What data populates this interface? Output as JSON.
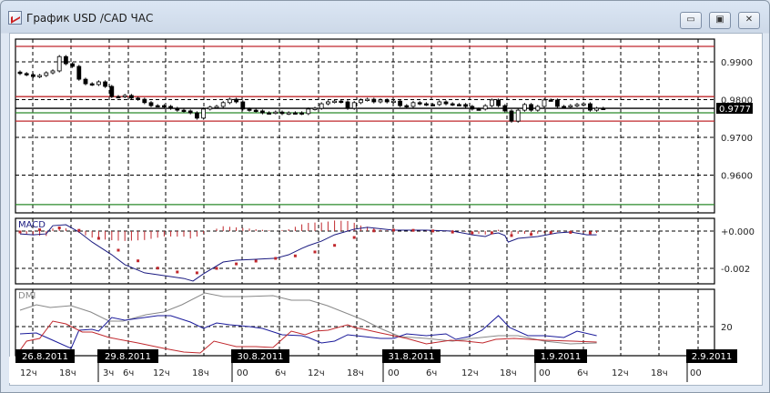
{
  "window": {
    "title": "График USD /CAD  ЧАС",
    "minimize_icon": "minimize-icon",
    "maximize_icon": "restore-icon",
    "close_icon": "close-icon"
  },
  "chart_data": [
    {
      "type": "candlestick",
      "title": "USD/CAD",
      "timeframe": "hourly",
      "y_ticks": [
        "0.9900",
        "0.9800",
        "0.9700",
        "0.9600"
      ],
      "ylim": [
        0.952,
        0.996
      ],
      "current_price": "0.9777",
      "levels": [
        {
          "price": 0.9941,
          "color": "#c0282d"
        },
        {
          "price": 0.9808,
          "color": "#c0282d"
        },
        {
          "price": 0.9743,
          "color": "#c0282d"
        },
        {
          "price": 0.9765,
          "color": "#2a8a2a"
        },
        {
          "price": 0.9522,
          "color": "#2a8a2a"
        },
        {
          "price": 0.9777,
          "color": "#000000"
        }
      ],
      "closes": [
        0.9869,
        0.9866,
        0.9861,
        0.9864,
        0.9871,
        0.9876,
        0.9914,
        0.9895,
        0.9888,
        0.9854,
        0.9842,
        0.984,
        0.9847,
        0.9835,
        0.9808,
        0.9808,
        0.9811,
        0.9804,
        0.9801,
        0.9792,
        0.9784,
        0.9784,
        0.9782,
        0.9777,
        0.9772,
        0.977,
        0.9765,
        0.9751,
        0.9775,
        0.978,
        0.9782,
        0.9792,
        0.9801,
        0.9794,
        0.9775,
        0.9772,
        0.977,
        0.9765,
        0.9765,
        0.9767,
        0.9763,
        0.9765,
        0.9765,
        0.9763,
        0.9775,
        0.9777,
        0.9789,
        0.9794,
        0.9796,
        0.9794,
        0.9777,
        0.9792,
        0.9799,
        0.9801,
        0.9794,
        0.9799,
        0.9794,
        0.9796,
        0.9784,
        0.9782,
        0.9792,
        0.9789,
        0.9787,
        0.9787,
        0.9794,
        0.9789,
        0.9787,
        0.9787,
        0.9782,
        0.9775,
        0.9775,
        0.9784,
        0.9799,
        0.9784,
        0.977,
        0.9743,
        0.9772,
        0.9787,
        0.9772,
        0.9782,
        0.9799,
        0.9799,
        0.9782,
        0.9782,
        0.9784,
        0.9787,
        0.9789,
        0.9772,
        0.9777,
        0.9777
      ]
    },
    {
      "type": "line",
      "title": "MACD",
      "y_ticks": [
        "+0.000",
        "-0.002"
      ],
      "units": "0.001",
      "macd": [
        [
          0,
          -0.15
        ],
        [
          2,
          -0.2
        ],
        [
          4,
          -0.15
        ],
        [
          5,
          0.29
        ],
        [
          7,
          0.34
        ],
        [
          9,
          -0.05
        ],
        [
          11,
          -0.59
        ],
        [
          14,
          -1.27
        ],
        [
          16,
          -1.8
        ],
        [
          19,
          -2.24
        ],
        [
          22,
          -2.39
        ],
        [
          25,
          -2.54
        ],
        [
          26.4,
          -2.68
        ],
        [
          28,
          -2.29
        ],
        [
          31,
          -1.66
        ],
        [
          33,
          -1.56
        ],
        [
          36,
          -1.51
        ],
        [
          39,
          -1.46
        ],
        [
          41,
          -1.27
        ],
        [
          43,
          -0.93
        ],
        [
          44,
          -0.78
        ],
        [
          46,
          -0.54
        ],
        [
          48,
          -0.2
        ],
        [
          51,
          0.1
        ],
        [
          53,
          0.2
        ],
        [
          57,
          0.05
        ],
        [
          62,
          0.05
        ],
        [
          66,
          0
        ],
        [
          69,
          -0.2
        ],
        [
          71,
          -0.29
        ],
        [
          72,
          -0.15
        ],
        [
          73,
          -0.1
        ],
        [
          74,
          -0.24
        ],
        [
          74.5,
          -0.59
        ],
        [
          76,
          -0.39
        ],
        [
          79,
          -0.29
        ],
        [
          82,
          -0.1
        ],
        [
          84,
          -0.05
        ],
        [
          86.5,
          -0.2
        ],
        [
          88,
          -0.2
        ]
      ],
      "signal": [
        [
          0,
          -0.05
        ],
        [
          5,
          0.15
        ],
        [
          7.4,
          0.2
        ],
        [
          9.4,
          0
        ],
        [
          12,
          -0.39
        ],
        [
          14,
          -0.78
        ],
        [
          16,
          -1.27
        ],
        [
          19,
          -1.76
        ],
        [
          22,
          -2.1
        ],
        [
          25,
          -2.24
        ],
        [
          27,
          -2.24
        ],
        [
          30,
          -2.0
        ],
        [
          33,
          -1.76
        ],
        [
          37,
          -1.56
        ],
        [
          41,
          -1.37
        ],
        [
          43.5,
          -1.27
        ],
        [
          45,
          -1.12
        ],
        [
          47,
          -0.88
        ],
        [
          50,
          -0.54
        ],
        [
          52.5,
          -0.05
        ],
        [
          55,
          0.05
        ],
        [
          59,
          0.05
        ],
        [
          63.6,
          0
        ],
        [
          68,
          -0.1
        ],
        [
          72,
          -0.1
        ],
        [
          74,
          -0.24
        ],
        [
          76,
          -0.24
        ],
        [
          79,
          -0.15
        ],
        [
          82,
          -0.05
        ],
        [
          87,
          -0.1
        ]
      ]
    },
    {
      "type": "line",
      "title": "DMI",
      "y_ticks": [
        "20"
      ],
      "adx": [
        [
          0,
          29
        ],
        [
          2.5,
          32
        ],
        [
          4.6,
          30.5
        ],
        [
          7.8,
          31.5
        ],
        [
          10.8,
          28
        ],
        [
          13.6,
          23
        ],
        [
          15.7,
          23
        ],
        [
          19.2,
          26.5
        ],
        [
          21.9,
          28
        ],
        [
          24.7,
          32
        ],
        [
          28.2,
          38.5
        ],
        [
          31,
          36.5
        ],
        [
          34.4,
          36.5
        ],
        [
          38.6,
          37
        ],
        [
          41.4,
          34.5
        ],
        [
          44.2,
          34.5
        ],
        [
          46.9,
          31.5
        ],
        [
          49.7,
          27.5
        ],
        [
          52.5,
          23.5
        ],
        [
          55.3,
          18.5
        ],
        [
          58,
          14.5
        ],
        [
          62,
          13.5
        ],
        [
          66,
          12
        ],
        [
          69,
          13.5
        ],
        [
          73,
          15
        ],
        [
          76,
          15
        ],
        [
          80,
          12
        ],
        [
          84,
          10.5
        ],
        [
          88,
          11
        ]
      ],
      "plus_di": [
        [
          0,
          16
        ],
        [
          2.5,
          16.5
        ],
        [
          5,
          12.5
        ],
        [
          7.8,
          8
        ],
        [
          9,
          18
        ],
        [
          11,
          18.5
        ],
        [
          12,
          17.5
        ],
        [
          14,
          25
        ],
        [
          16,
          23.5
        ],
        [
          18,
          24.5
        ],
        [
          21,
          26
        ],
        [
          23,
          26
        ],
        [
          26,
          22.5
        ],
        [
          28,
          19
        ],
        [
          30,
          22
        ],
        [
          32,
          21
        ],
        [
          35,
          20
        ],
        [
          37,
          19
        ],
        [
          40,
          15.5
        ],
        [
          43,
          15
        ],
        [
          44,
          14
        ],
        [
          46,
          11
        ],
        [
          48,
          12
        ],
        [
          50,
          15.5
        ],
        [
          52.5,
          14.5
        ],
        [
          55,
          13.5
        ],
        [
          57,
          13.5
        ],
        [
          59,
          16
        ],
        [
          62,
          15
        ],
        [
          65,
          16
        ],
        [
          66.5,
          13
        ],
        [
          68.5,
          14.5
        ],
        [
          70.5,
          18
        ],
        [
          73,
          26
        ],
        [
          74.7,
          19.5
        ],
        [
          77.5,
          15
        ],
        [
          80,
          15
        ],
        [
          83,
          14
        ],
        [
          85,
          17.5
        ],
        [
          88,
          15
        ]
      ],
      "minus_di": [
        [
          0,
          7
        ],
        [
          1,
          12
        ],
        [
          3,
          13.5
        ],
        [
          5,
          23
        ],
        [
          7,
          21.5
        ],
        [
          9.5,
          17
        ],
        [
          11,
          17
        ],
        [
          13.6,
          14
        ],
        [
          18,
          11
        ],
        [
          22,
          8
        ],
        [
          25,
          6
        ],
        [
          27.5,
          5.5
        ],
        [
          29.6,
          12
        ],
        [
          33,
          9
        ],
        [
          36,
          9
        ],
        [
          38.6,
          8.5
        ],
        [
          41.4,
          17.5
        ],
        [
          43.5,
          15.5
        ],
        [
          45,
          17.5
        ],
        [
          47,
          18
        ],
        [
          50,
          21
        ],
        [
          51,
          19.5
        ],
        [
          52.5,
          18.5
        ],
        [
          55,
          16.5
        ],
        [
          59,
          13.5
        ],
        [
          62,
          10.5
        ],
        [
          65.7,
          12.5
        ],
        [
          68,
          12
        ],
        [
          70.6,
          11
        ],
        [
          72.6,
          13
        ],
        [
          75.4,
          13.5
        ],
        [
          80,
          12.5
        ],
        [
          84.4,
          12
        ],
        [
          88,
          11.5
        ]
      ]
    }
  ],
  "time_axis": {
    "dates": [
      "26.8.2011",
      "29.8.2011",
      "30.8.2011",
      "31.8.2011",
      "1.9.2011",
      "2.9.2011"
    ],
    "hours": [
      "12ч",
      "18ч",
      "3ч",
      "6ч",
      "12ч",
      "18ч",
      "00",
      "6ч",
      "12ч",
      "18ч",
      "00",
      "6ч",
      "12ч",
      "18ч",
      "00",
      "6ч",
      "12ч",
      "18ч",
      "00"
    ]
  }
}
